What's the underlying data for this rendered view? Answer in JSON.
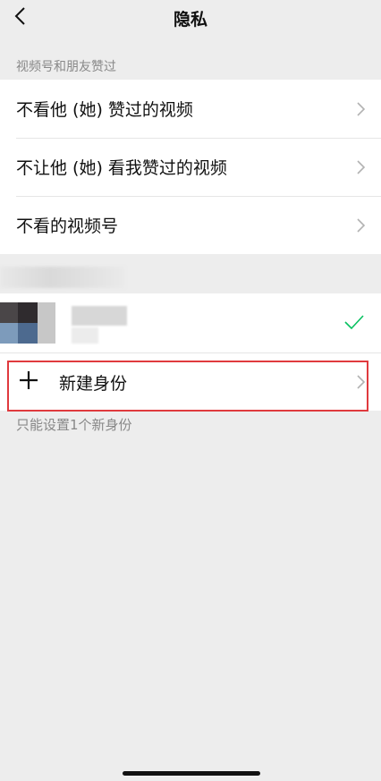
{
  "nav": {
    "title": "隐私",
    "back_icon": "chevron-left-icon"
  },
  "section": {
    "label": "视频号和朋友赞过"
  },
  "rows": [
    {
      "label": "不看他 (她) 赞过的视频"
    },
    {
      "label": "不让他 (她) 看我赞过的视频"
    },
    {
      "label": "不看的视频号"
    }
  ],
  "identity": {
    "selected_icon": "check-icon",
    "accent": "#07c160"
  },
  "new_identity": {
    "label": "新建身份",
    "icon": "plus-icon"
  },
  "footer_note": "只能设置1个新身份",
  "colors": {
    "background": "#ededed",
    "highlight": "#e03a3e"
  }
}
